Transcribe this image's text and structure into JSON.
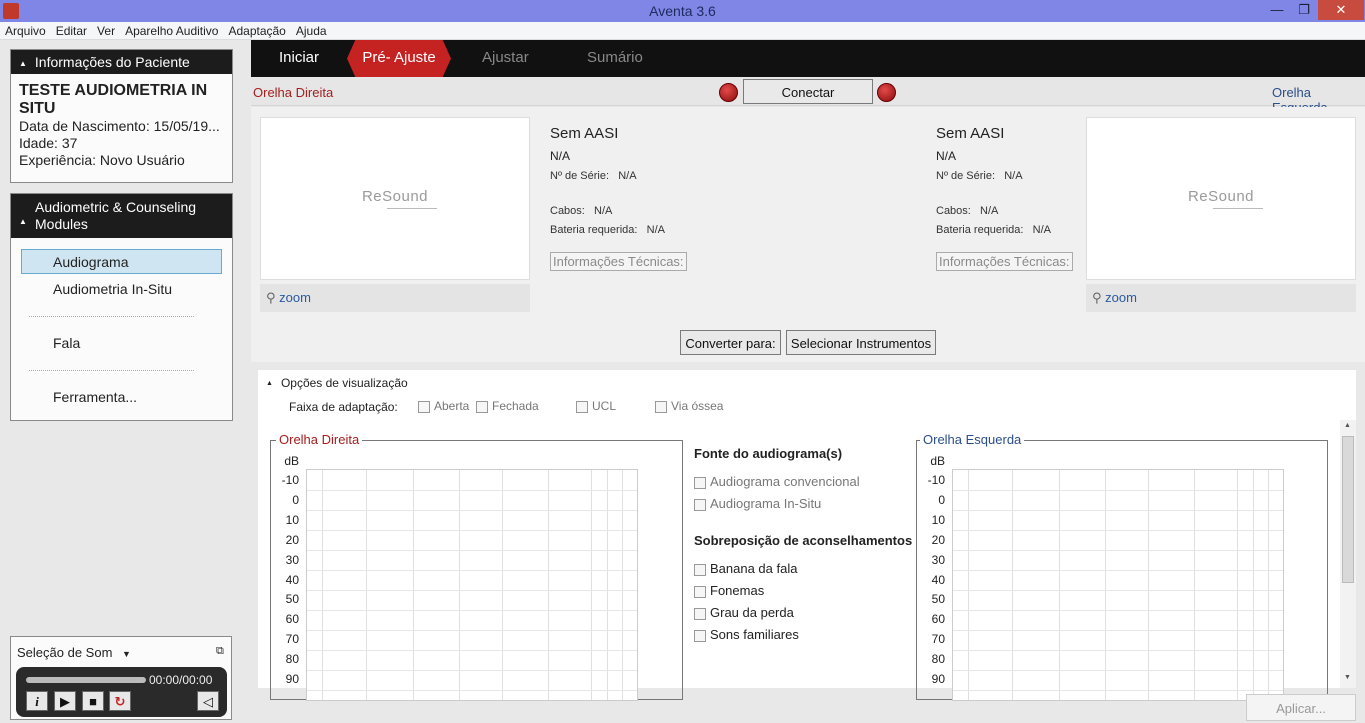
{
  "window": {
    "title": "Aventa 3.6"
  },
  "menu": [
    "Arquivo",
    "Editar",
    "Ver",
    "Aparelho Auditivo",
    "Adaptação",
    "Ajuda"
  ],
  "patient": {
    "header": "Informações do Paciente",
    "name": "TESTE AUDIOMETRIA IN SITU",
    "birth": "Data de Nascimento: 15/05/19...",
    "age": "Idade: 37",
    "experience": "Experiência: Novo Usuário"
  },
  "modules": {
    "header": "Audiometric & Counseling Modules",
    "items": [
      "Audiograma",
      "Audiometria In-Situ",
      "Fala",
      "Ferramenta..."
    ]
  },
  "sound": {
    "label": "Seleção de Som",
    "time": "00:00/00:00"
  },
  "tabs": [
    "Iniciar",
    "Pré- Ajuste",
    "Ajustar",
    "Sumário"
  ],
  "connect": {
    "right_ear": "Orelha Direita",
    "left_ear": "Orelha Esquerda",
    "button": "Conectar"
  },
  "device_right": {
    "brand": "ReSound",
    "zoom": "zoom",
    "title": "Sem AASI",
    "model": "N/A",
    "serial_label": "Nº de Série:",
    "serial": "N/A",
    "cables_label": "Cabos:",
    "cables": "N/A",
    "battery_label": "Bateria requerida:",
    "battery": "N/A",
    "tech_info": "Informações Técnicas:"
  },
  "device_left": {
    "brand": "ReSound",
    "zoom": "zoom",
    "title": "Sem AASI",
    "model": "N/A",
    "serial_label": "Nº de Série:",
    "serial": "N/A",
    "cables_label": "Cabos:",
    "cables": "N/A",
    "battery_label": "Bateria requerida:",
    "battery": "N/A",
    "tech_info": "Informações Técnicas:"
  },
  "convert": {
    "button": "Converter para:",
    "select": "Selecionar Instrumentos"
  },
  "viz": {
    "header": "Opções de visualização",
    "range_label": "Faixa de adaptação:",
    "range_opts": [
      "Aberta",
      "Fechada",
      "UCL",
      "Via óssea"
    ],
    "source_title": "Fonte do audiograma(s)",
    "source_opts": [
      "Audiograma convencional",
      "Audiograma In-Situ"
    ],
    "overlay_title": "Sobreposição de aconselhamentos",
    "overlay_opts": [
      "Banana da fala",
      "Fonemas",
      "Grau da perda",
      "Sons familiares"
    ],
    "right_chart": "Orelha Direita",
    "left_chart": "Orelha Esquerda",
    "db_label": "dB",
    "y_ticks": [
      "-10",
      "0",
      "10",
      "20",
      "30",
      "40",
      "50",
      "60",
      "70",
      "80",
      "90"
    ]
  },
  "apply": "Aplicar...",
  "colors": {
    "accent_red": "#c52222",
    "right_ear": "#a41e1e",
    "left_ear": "#2a4e8a",
    "selected": "#cfe6f2"
  }
}
